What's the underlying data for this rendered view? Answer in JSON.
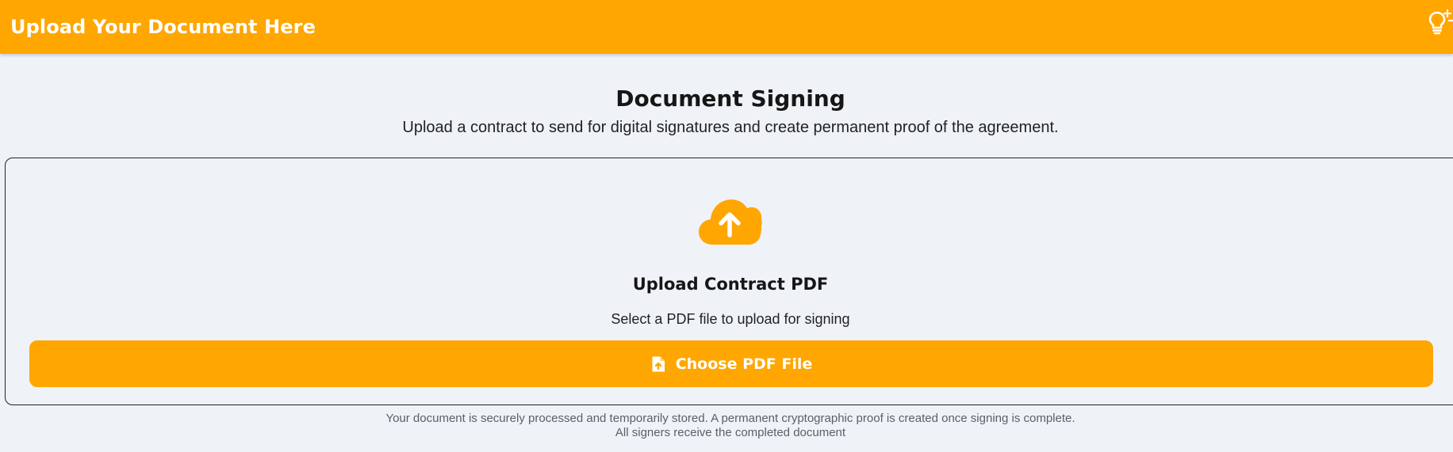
{
  "header": {
    "title": "Upload Your Document Here",
    "theme_toggle_icon": "lightbulb-sparkle-icon",
    "background_color": "#ffa600"
  },
  "main": {
    "heading": "Document Signing",
    "subheading": "Upload a contract to send for digital signatures and create permanent proof of the agreement."
  },
  "upload_card": {
    "icon": "cloud-upload-icon",
    "title": "Upload Contract PDF",
    "description": "Select a PDF file to upload for signing",
    "button_label": "Choose PDF File",
    "button_icon": "file-upload-icon",
    "accent_color": "#ffa600"
  },
  "footer": {
    "note_line1": "Your document is securely processed and temporarily stored. A permanent cryptographic proof is created once signing is complete.",
    "note_line2": "All signers receive the completed document"
  }
}
